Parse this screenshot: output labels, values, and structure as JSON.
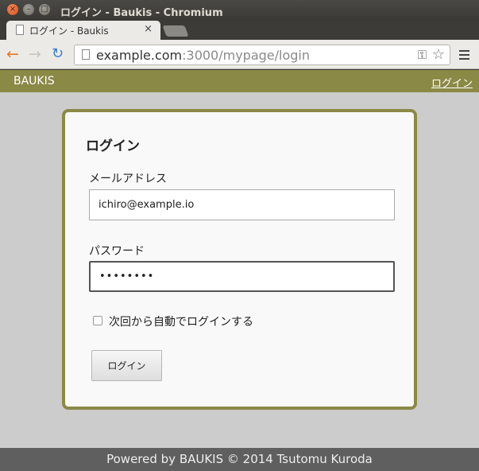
{
  "window": {
    "title": "ログイン - Baukis - Chromium",
    "close_glyph": "×",
    "min_glyph": "–",
    "max_glyph": "□"
  },
  "tab": {
    "title": "ログイン - Baukis",
    "close_glyph": "×"
  },
  "toolbar": {
    "back_icon": "←",
    "forward_icon": "→",
    "reload_icon": "↻",
    "url_host": "example.com",
    "url_path": ":3000/mypage/login",
    "key_icon": "⚿",
    "star_icon": "☆"
  },
  "site": {
    "title": "BAUKIS",
    "login_link": "ログイン"
  },
  "form": {
    "heading": "ログイン",
    "email_label": "メールアドレス",
    "email_value": "ichiro@example.io",
    "password_label": "パスワード",
    "password_value": "••••••••",
    "remember_label": "次回から自動でログインする",
    "remember_checked": false,
    "submit_label": "ログイン"
  },
  "footer": {
    "text": "Powered by BAUKIS © 2014 Tsutomu Kuroda"
  },
  "colors": {
    "accent": "#8b8946",
    "page_bg": "#cccccc",
    "footer_bg": "#5f5f5f"
  }
}
